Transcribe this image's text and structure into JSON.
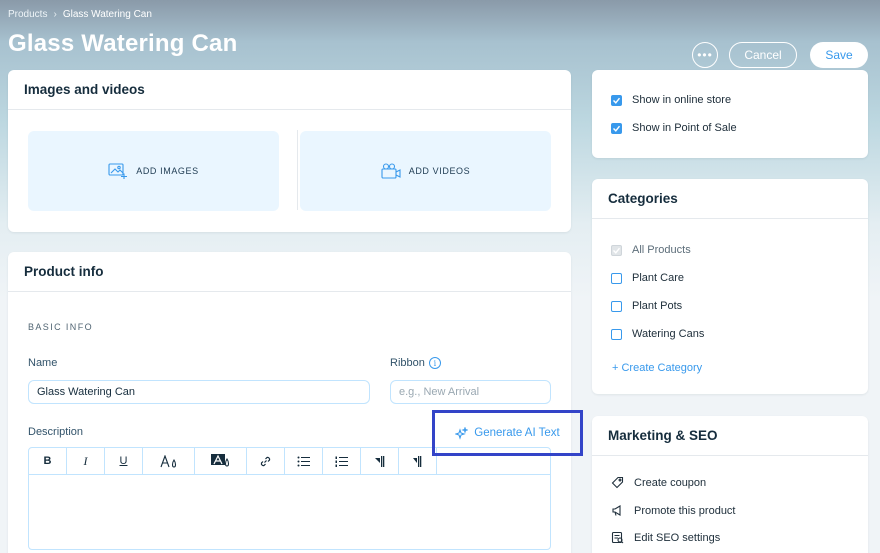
{
  "header": {
    "breadcrumb": {
      "parent": "Products",
      "separator": "›",
      "current": "Glass Watering Can"
    },
    "title": "Glass Watering Can",
    "actions": {
      "more_label": "•••",
      "cancel_label": "Cancel",
      "save_label": "Save"
    }
  },
  "media": {
    "title": "Images and videos",
    "add_images_label": "ADD IMAGES",
    "add_videos_label": "ADD VIDEOS"
  },
  "product_info": {
    "title": "Product info",
    "section_label": "BASIC INFO",
    "name": {
      "label": "Name",
      "value": "Glass Watering Can"
    },
    "ribbon": {
      "label": "Ribbon",
      "info_icon": "i",
      "placeholder": "e.g., New Arrival"
    },
    "description": {
      "label": "Description",
      "generate_ai_label": "Generate AI Text",
      "toolbar": [
        "bold",
        "italic",
        "underline",
        "font-size",
        "text-color",
        "link",
        "bullet-list",
        "numbered-list",
        "indent-left",
        "indent-right"
      ]
    }
  },
  "visibility": {
    "items": [
      {
        "label": "Show in online store",
        "checked": true
      },
      {
        "label": "Show in Point of Sale",
        "checked": true
      }
    ]
  },
  "categories": {
    "title": "Categories",
    "items": [
      {
        "label": "All Products",
        "checked": true,
        "disabled": true
      },
      {
        "label": "Plant Care",
        "checked": false
      },
      {
        "label": "Plant Pots",
        "checked": false
      },
      {
        "label": "Watering Cans",
        "checked": false
      }
    ],
    "create_label": "+ Create Category"
  },
  "marketing": {
    "title": "Marketing & SEO",
    "items": [
      {
        "label": "Create coupon",
        "icon": "tag-icon"
      },
      {
        "label": "Promote this product",
        "icon": "megaphone-icon"
      },
      {
        "label": "Edit SEO settings",
        "icon": "seo-icon"
      }
    ]
  },
  "colors": {
    "accent": "#3899ec",
    "highlight_border": "#3344c8",
    "media_bg": "#eaf6ff"
  }
}
